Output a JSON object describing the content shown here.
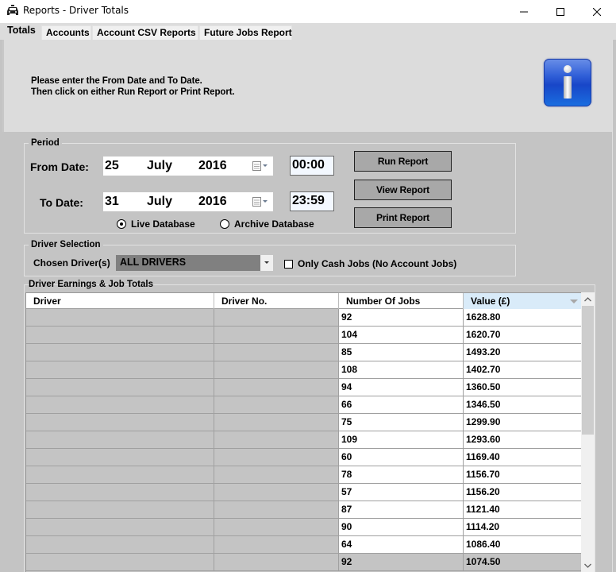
{
  "window": {
    "title": "Reports - Driver Totals",
    "icon": "taxi-icon",
    "controls": [
      "minimize-icon",
      "maximize-icon",
      "close-icon"
    ]
  },
  "tabs": [
    {
      "label": "Totals",
      "active": true
    },
    {
      "label": "Accounts",
      "active": false
    },
    {
      "label": "Account CSV Reports",
      "active": false
    },
    {
      "label": "Future Jobs Report",
      "active": false
    }
  ],
  "info": {
    "line1": "Please enter the From Date and To Date.",
    "line2": "Then click on either Run Report or Print Report.",
    "icon": "info-icon"
  },
  "period": {
    "label": "Period",
    "from_label": "From Date:",
    "from_day": "25",
    "from_month": "July",
    "from_year": "2016",
    "from_time": "00:00",
    "to_label": "To  Date:",
    "to_day": "31",
    "to_month": "July",
    "to_year": "2016",
    "to_time": "23:59",
    "live_db_label": "Live Database",
    "archive_db_label": "Archive Database",
    "selected_db": "Live Database"
  },
  "actions": {
    "run": "Run Report",
    "view": "View Report",
    "print": "Print Report"
  },
  "driver_selection": {
    "label": "Driver Selection",
    "chosen_label": "Chosen Driver(s)",
    "chosen_value": "ALL DRIVERS",
    "cash_only_label": "Only Cash Jobs (No Account Jobs)",
    "cash_only_checked": false
  },
  "earnings": {
    "label": "Driver Earnings & Job Totals",
    "columns": [
      "Driver",
      "Driver No.",
      "Number Of Jobs",
      "Value (£)"
    ],
    "sorted_column": "Value (£)",
    "rows": [
      {
        "driver": "",
        "driver_no": "",
        "jobs": "92",
        "value": "1628.80"
      },
      {
        "driver": "",
        "driver_no": "",
        "jobs": "104",
        "value": "1620.70"
      },
      {
        "driver": "",
        "driver_no": "",
        "jobs": "85",
        "value": "1493.20"
      },
      {
        "driver": "",
        "driver_no": "",
        "jobs": "108",
        "value": "1402.70"
      },
      {
        "driver": "",
        "driver_no": "",
        "jobs": "94",
        "value": "1360.50"
      },
      {
        "driver": "",
        "driver_no": "",
        "jobs": "66",
        "value": "1346.50"
      },
      {
        "driver": "",
        "driver_no": "",
        "jobs": "75",
        "value": "1299.90"
      },
      {
        "driver": "",
        "driver_no": "",
        "jobs": "109",
        "value": "1293.60"
      },
      {
        "driver": "",
        "driver_no": "",
        "jobs": "60",
        "value": "1169.40"
      },
      {
        "driver": "",
        "driver_no": "",
        "jobs": "78",
        "value": "1156.70"
      },
      {
        "driver": "",
        "driver_no": "",
        "jobs": "57",
        "value": "1156.20"
      },
      {
        "driver": "",
        "driver_no": "",
        "jobs": "87",
        "value": "1121.40"
      },
      {
        "driver": "",
        "driver_no": "",
        "jobs": "90",
        "value": "1114.20"
      },
      {
        "driver": "",
        "driver_no": "",
        "jobs": "64",
        "value": "1086.40"
      },
      {
        "driver": "",
        "driver_no": "",
        "jobs": "92",
        "value": "1074.50",
        "selected": true
      }
    ]
  },
  "colors": {
    "window_bg": "#c4c4c4",
    "panel_bg": "#dcdcdc",
    "button_bg": "#a8a8a8",
    "select_bg": "#808080",
    "sorted_header_bg": "#d9ebf9",
    "time_box_bg": "#f3f8ff"
  }
}
